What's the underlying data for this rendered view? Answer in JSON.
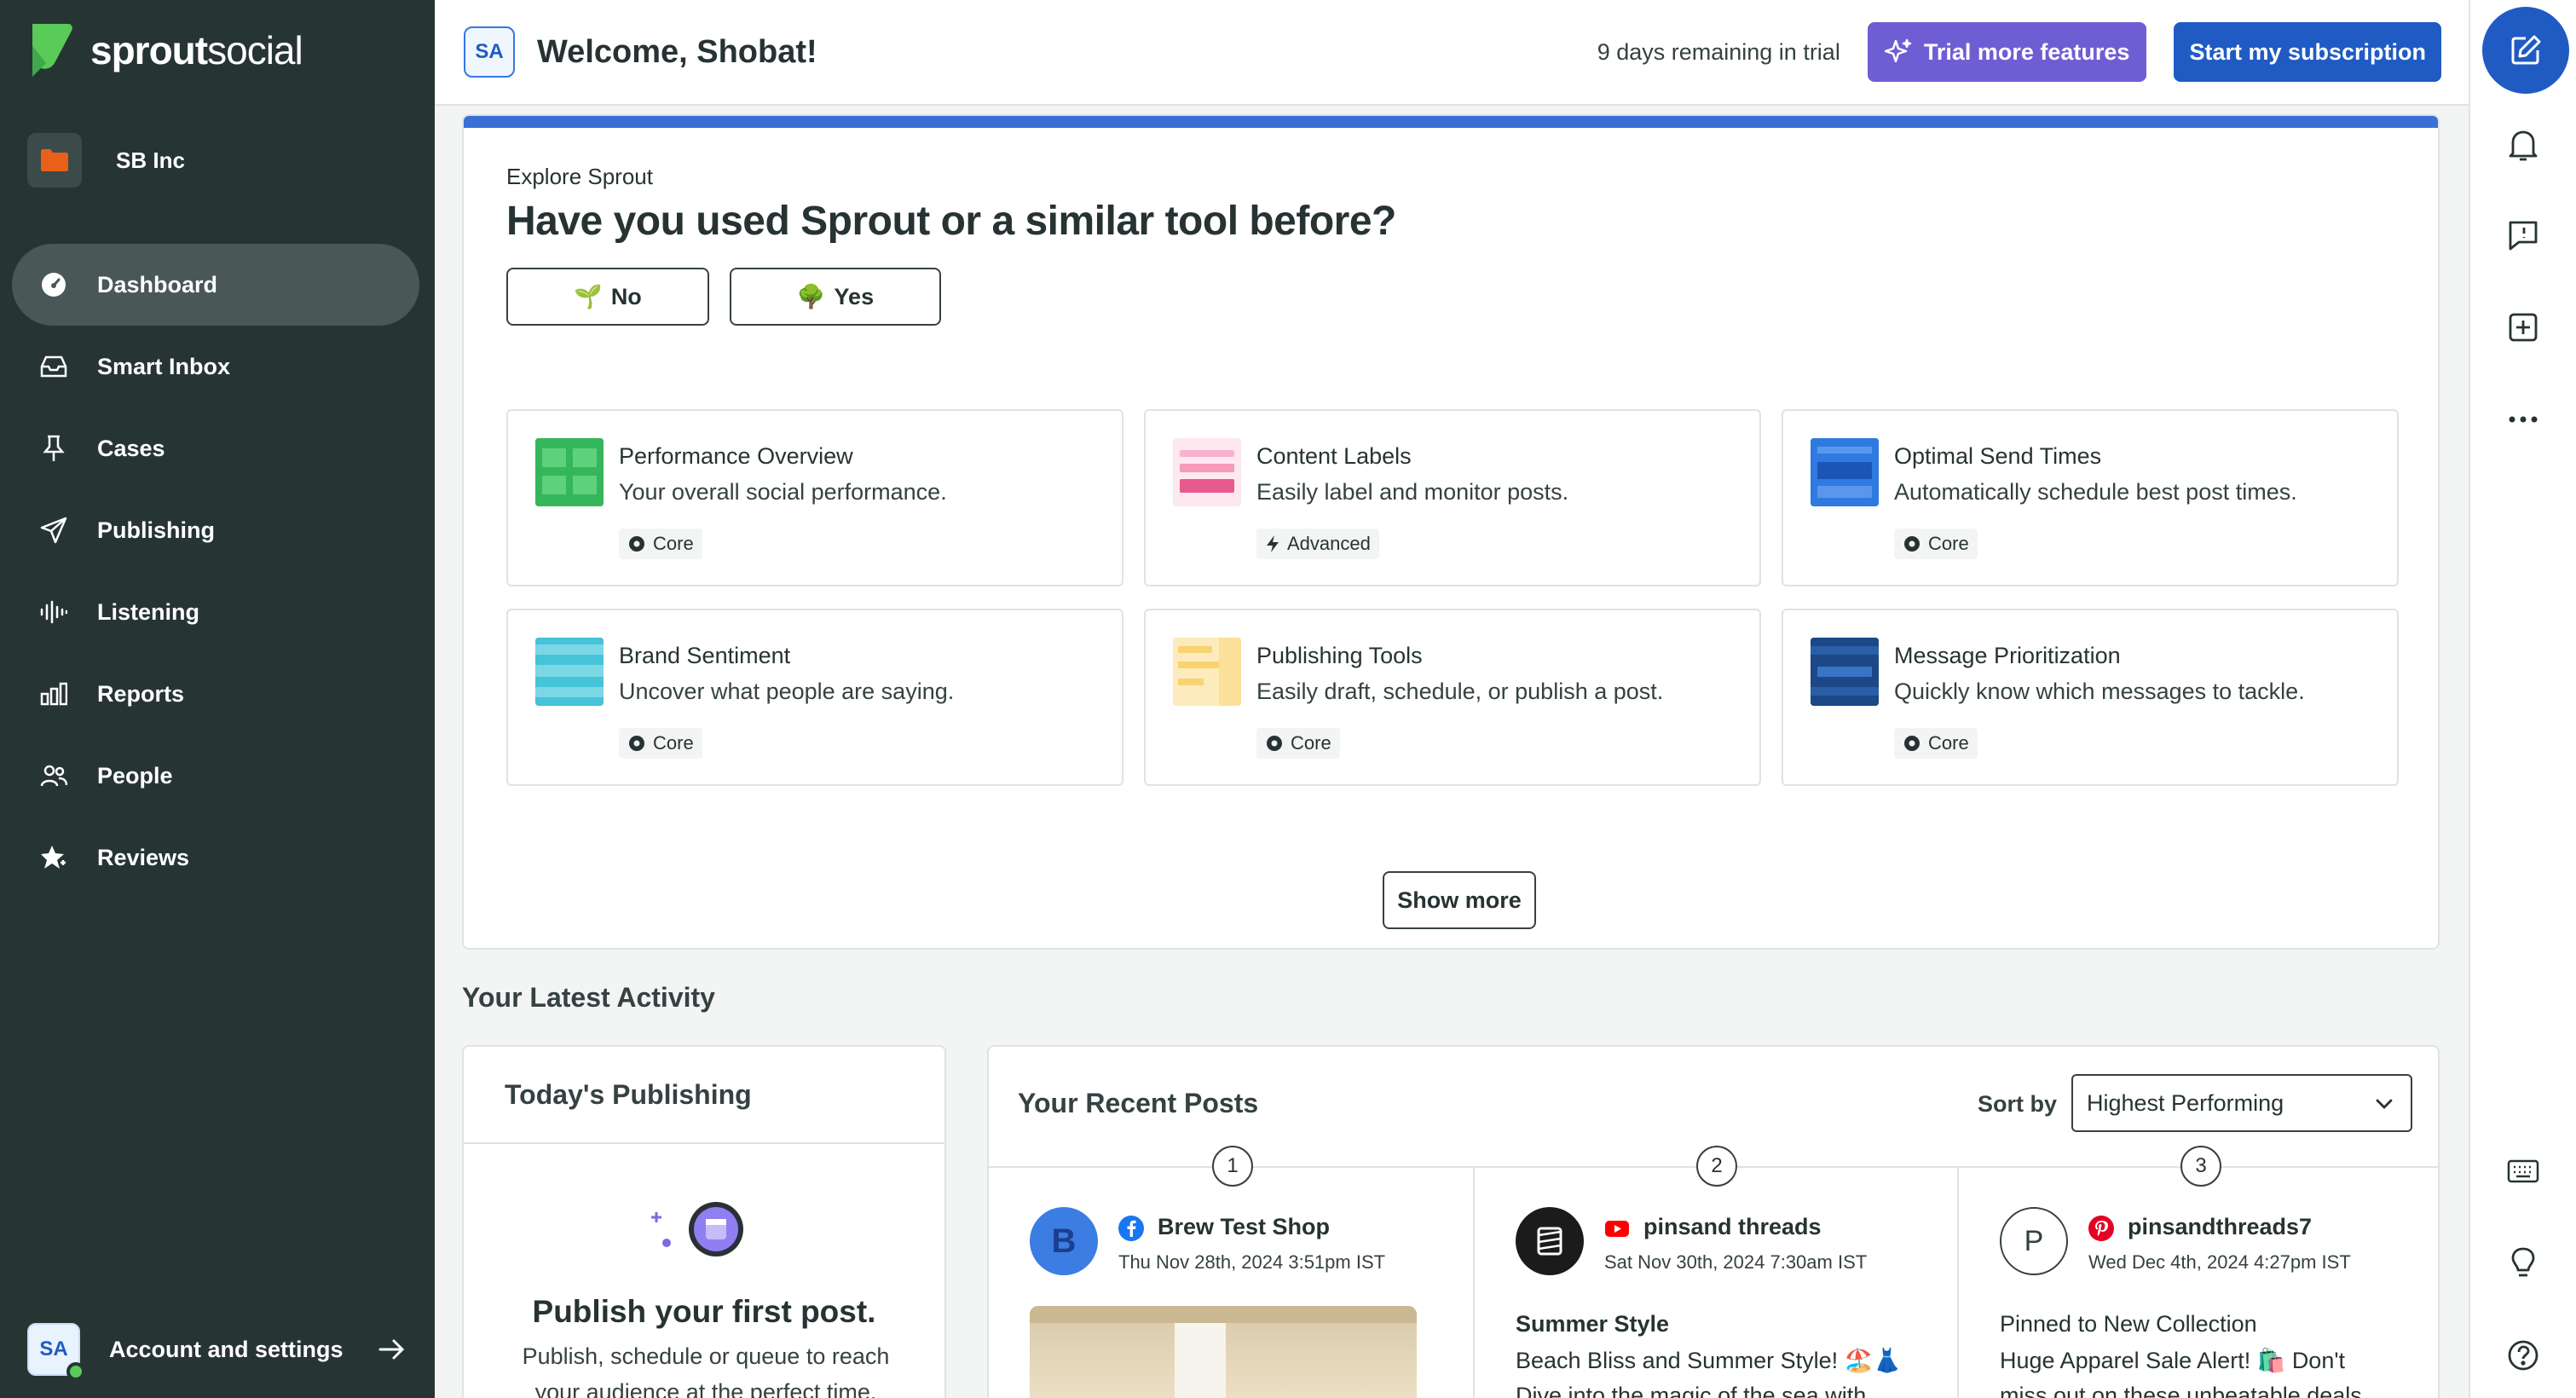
{
  "brand": {
    "logo_bold": "sprout",
    "logo_light": "social",
    "colors": {
      "sidebar": "#273434",
      "primary": "#205bc3",
      "trial": "#6f5ed3",
      "accent_green": "#59cb59"
    }
  },
  "org": {
    "name": "SB Inc"
  },
  "nav": {
    "items": [
      {
        "label": "Dashboard",
        "icon": "dashboard-gauge-icon"
      },
      {
        "label": "Smart Inbox",
        "icon": "inbox-icon"
      },
      {
        "label": "Cases",
        "icon": "pin-icon"
      },
      {
        "label": "Publishing",
        "icon": "paper-plane-icon"
      },
      {
        "label": "Listening",
        "icon": "waveform-icon"
      },
      {
        "label": "Reports",
        "icon": "bar-chart-icon"
      },
      {
        "label": "People",
        "icon": "people-icon"
      },
      {
        "label": "Reviews",
        "icon": "star-icon"
      }
    ]
  },
  "account": {
    "initials": "SA",
    "label": "Account and settings"
  },
  "topbar": {
    "initials": "SA",
    "welcome": "Welcome, Shobat!",
    "trial_remaining": "9 days remaining in trial",
    "trial_button": "Trial more features",
    "subscribe_button": "Start my subscription"
  },
  "explore": {
    "eyebrow": "Explore Sprout",
    "title": "Have you used Sprout or a similar tool before?",
    "no_label": "No",
    "yes_label": "Yes",
    "no_emoji": "🌱",
    "yes_emoji": "🌳",
    "cards": [
      {
        "title": "Performance Overview",
        "desc": "Your overall social performance.",
        "badge": "Core"
      },
      {
        "title": "Content Labels",
        "desc": "Easily label and monitor posts.",
        "badge": "Advanced"
      },
      {
        "title": "Optimal Send Times",
        "desc": "Automatically schedule best post times.",
        "badge": "Core"
      },
      {
        "title": "Brand Sentiment",
        "desc": "Uncover what people are saying.",
        "badge": "Core"
      },
      {
        "title": "Publishing Tools",
        "desc": "Easily draft, schedule, or publish a post.",
        "badge": "Core"
      },
      {
        "title": "Message Prioritization",
        "desc": "Quickly know which messages to tackle.",
        "badge": "Core"
      }
    ],
    "show_more": "Show more"
  },
  "activity": {
    "section_title": "Your Latest Activity",
    "today": {
      "title": "Today's Publishing",
      "empty_title": "Publish your first post.",
      "empty_desc": "Publish, schedule or queue to reach your audience at the perfect time."
    },
    "recent": {
      "title": "Your Recent Posts",
      "sort_label": "Sort by",
      "sort_value": "Highest Performing",
      "posts": [
        {
          "rank": "1",
          "avatar": "B",
          "network": "facebook-icon",
          "name": "Brew Test Shop",
          "date": "Thu Nov 28th, 2024 3:51pm IST"
        },
        {
          "rank": "2",
          "network": "youtube-icon",
          "name": "pinsand threads",
          "date": "Sat Nov 30th, 2024 7:30am IST",
          "line1": "Summer Style",
          "line2": "Beach Bliss and Summer Style! 🏖️👗",
          "line3": "Dive into the magic of the sea with"
        },
        {
          "rank": "3",
          "avatar": "P",
          "network": "pinterest-icon",
          "name": "pinsandthreads7",
          "date": "Wed Dec 4th, 2024 4:27pm IST",
          "line1": "Pinned to New Collection",
          "line2": "Huge Apparel Sale Alert! 🛍️ Don't",
          "line3": "miss out on these unbeatable deals"
        }
      ]
    }
  }
}
